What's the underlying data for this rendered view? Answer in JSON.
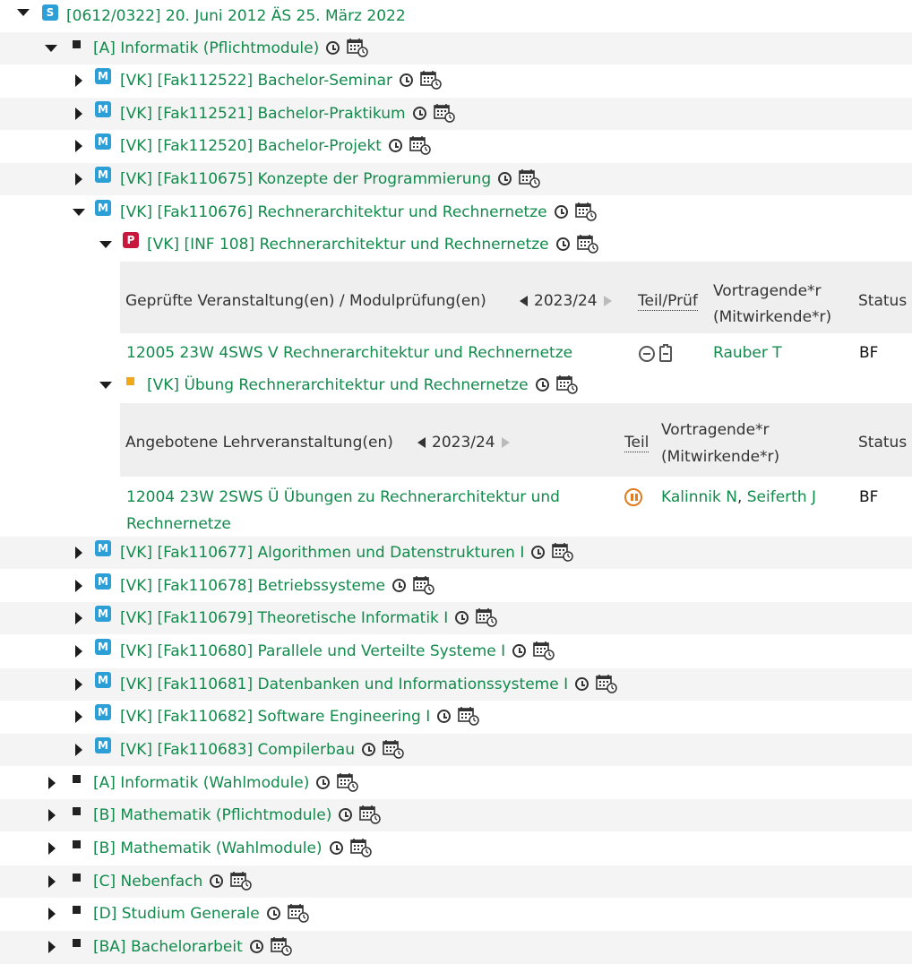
{
  "tree": {
    "root": "[0612/0322] 20. Juni 2012 ÄS 25. März 2022",
    "badges": {
      "s": "S",
      "m": "M",
      "p": "P"
    },
    "informatik_pflicht": "[A] Informatik (Pflichtmodule)",
    "modules_top": [
      "[VK] [Fak112522] Bachelor-Seminar",
      "[VK] [Fak112521] Bachelor-Praktikum",
      "[VK] [Fak112520] Bachelor-Projekt",
      "[VK] [Fak110675] Konzepte der Programmierung",
      "[VK] [Fak110676] Rechnerarchitektur und Rechnernetze"
    ],
    "pruefung": "[VK] [INF 108] Rechnerarchitektur und Rechnernetze",
    "uebung": "[VK] Übung Rechnerarchitektur und Rechnernetze",
    "modules_bottom": [
      "[VK] [Fak110677] Algorithmen und Datenstrukturen I",
      "[VK] [Fak110678] Betriebssysteme",
      "[VK] [Fak110679] Theoretische Informatik I",
      "[VK] [Fak110680] Parallele und Verteilte Systeme I",
      "[VK] [Fak110681] Datenbanken und Informationssysteme I",
      "[VK] [Fak110682] Software Engineering I",
      "[VK] [Fak110683] Compilerbau"
    ],
    "groups": [
      "[A] Informatik (Wahlmodule)",
      "[B] Mathematik (Pflichtmodule)",
      "[B] Mathematik (Wahlmodule)",
      "[C] Nebenfach",
      "[D] Studium Generale",
      "[BA] Bachelorarbeit"
    ]
  },
  "exam_table": {
    "header_col1": "Geprüfte Veranstaltung(en) / Modulprüfung(en)",
    "semester": "2023/24",
    "header_teil": "Teil/Prüf",
    "header_vortr_1": "Vortragende*r",
    "header_vortr_2": "(Mitwirkende*r)",
    "header_status": "Status",
    "row_title": "12005 23W 4SWS V Rechnerarchitektur und Rechnernetze",
    "row_person": "Rauber T",
    "row_status": "BF"
  },
  "course_table": {
    "header_col1": "Angebotene Lehrveranstaltung(en)",
    "semester": "2023/24",
    "header_teil": "Teil",
    "header_vortr_1": "Vortragende*r",
    "header_vortr_2": "(Mitwirkende*r)",
    "header_status": "Status",
    "row_title_1": "12004 23W 2SWS Ü Übungen zu Rechnerarchitektur und",
    "row_title_2": "Rechnernetze",
    "row_person_1": "Kalinnik N",
    "row_sep": ", ",
    "row_person_2": "Seiferth J",
    "row_status": "BF"
  }
}
